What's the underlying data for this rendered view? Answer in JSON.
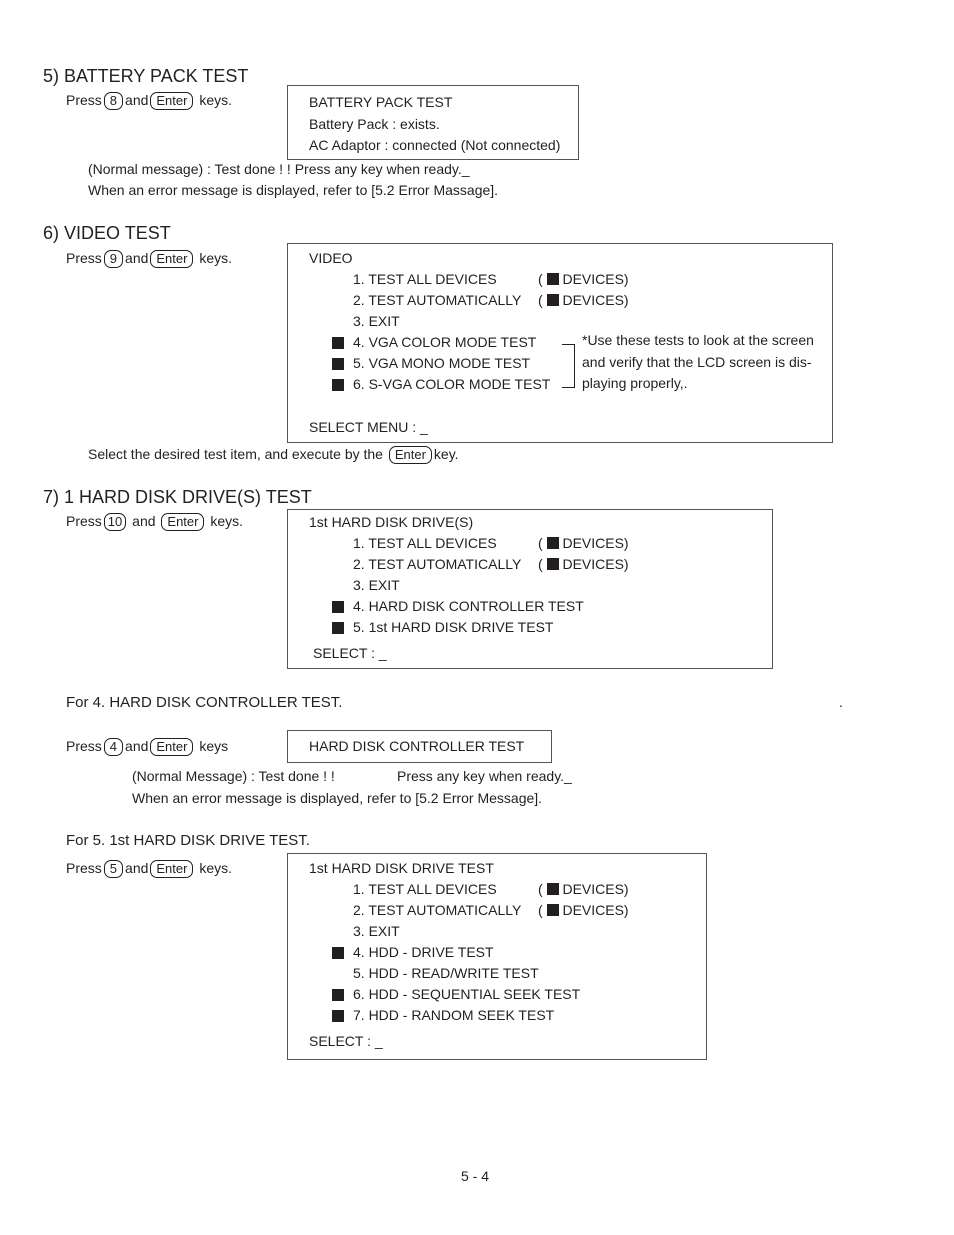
{
  "page_number": "5 - 4",
  "battery": {
    "heading": "5) BATTERY PACK TEST",
    "press": "Press",
    "key1": "8",
    "and": "and",
    "key2": "Enter",
    "keys": "keys.",
    "screen": [
      "BATTERY PACK TEST",
      "Battery Pack : exists.",
      "AC Adaptor : connected (Not connected)"
    ],
    "normal_msg": "(Normal message) :  Test  done ! !  Press any key when ready._",
    "error_msg": "When an error message is displayed, refer to [5.2 Error Massage]."
  },
  "video": {
    "heading": "6) VIDEO TEST",
    "press": "Press",
    "key1": "9",
    "and": "and",
    "key2": "Enter",
    "keys": "keys.",
    "title": "VIDEO",
    "items": [
      {
        "label": "1.  TEST ALL DEVICES",
        "suffix": "DEVICES)",
        "marker": false
      },
      {
        "label": "2.  TEST AUTOMATICALLY",
        "suffix": "DEVICES)",
        "marker": false
      },
      {
        "label": "3.  EXIT",
        "marker": false
      },
      {
        "label": "4.  VGA COLOR MODE TEST",
        "marker": true
      },
      {
        "label": "5.  VGA MONO MODE TEST",
        "marker": true
      },
      {
        "label": "6.  S-VGA COLOR MODE TEST",
        "marker": true
      }
    ],
    "note": [
      "*Use these tests to look at the screen",
      "and verify that the LCD screen is dis-",
      "playing properly,."
    ],
    "select": "SELECT MENU  :   _",
    "instruction_pre": "Select the desired test item, and execute by the",
    "instruction_key": "Enter",
    "instruction_post": "key."
  },
  "hdd": {
    "heading": "7)  1 HARD DISK DRIVE(S) TEST",
    "press": "Press",
    "key1": "10",
    "and": "and",
    "key2": "Enter",
    "keys": "keys.",
    "title": "1st  HARD DISK DRIVE(S)",
    "items": [
      {
        "label": "1.  TEST ALL DEVICES",
        "suffix": "DEVICES)"
      },
      {
        "label": "2.  TEST AUTOMATICALLY",
        "suffix": "DEVICES)"
      },
      {
        "label": "3.  EXIT"
      },
      {
        "label": "4.  HARD DISK CONTROLLER TEST",
        "marker": true
      },
      {
        "label": "5.  1st HARD DISK DRIVE TEST",
        "marker": true
      }
    ],
    "select": "SELECT :  _"
  },
  "controller": {
    "heading": "For  4.  HARD DISK CONTROLLER TEST.",
    "trailing_dot": ".",
    "press": "Press",
    "key1": "4",
    "and": "and",
    "key2": "Enter",
    "keys": "keys",
    "screen": "HARD DISK CONTROLLER TEST",
    "normal_msg_a": "(Normal Message) :  Test done ! !",
    "normal_msg_b": "Press any key when ready._",
    "error_msg": "When an error message is displayed, refer to [5.2 Error Message]."
  },
  "drive": {
    "heading": "For  5.  1st HARD DISK DRIVE TEST.",
    "press": "Press",
    "key1": "5",
    "and": "and",
    "key2": "Enter",
    "keys": "keys.",
    "title": "1st HARD DISK DRIVE TEST",
    "items": [
      {
        "label": "1.  TEST ALL DEVICES",
        "suffix": "DEVICES)"
      },
      {
        "label": "2.  TEST AUTOMATICALLY",
        "suffix": "DEVICES)"
      },
      {
        "label": "3.  EXIT"
      },
      {
        "label": "4.  HDD - DRIVE TEST",
        "marker": true
      },
      {
        "label": "5.  HDD - READ/WRITE TEST",
        "marker": false
      },
      {
        "label": "6.  HDD - SEQUENTIAL SEEK TEST",
        "marker": true
      },
      {
        "label": "7.  HDD - RANDOM SEEK TEST",
        "marker": true
      }
    ],
    "select": "SELECT  :  _"
  }
}
